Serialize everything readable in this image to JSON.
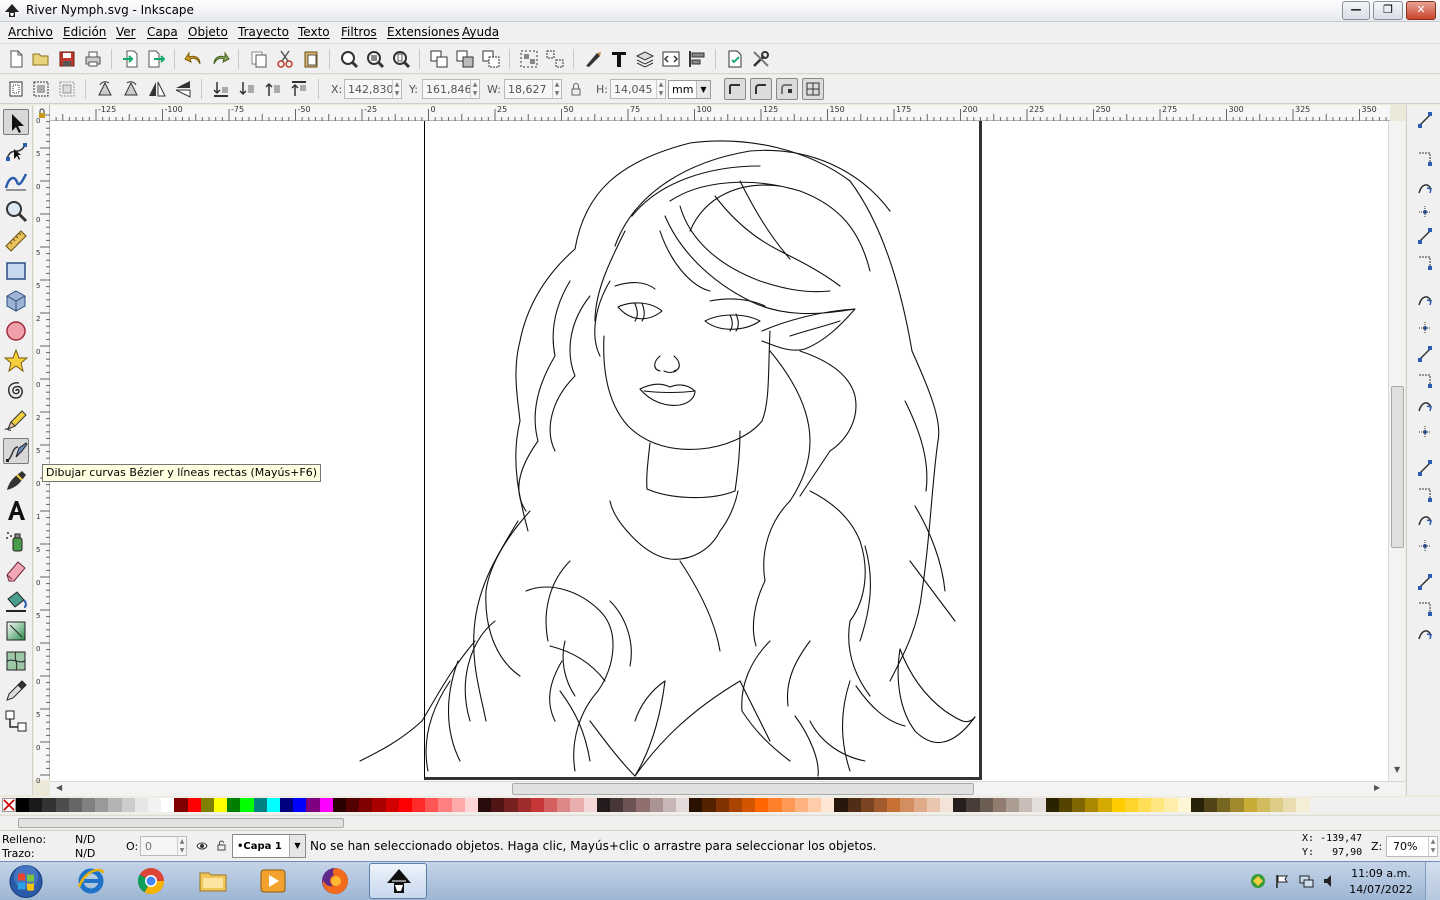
{
  "window": {
    "title": "River Nymph.svg - Inkscape"
  },
  "menu": [
    "Archivo",
    "Edición",
    "Ver",
    "Capa",
    "Objeto",
    "Trayecto",
    "Texto",
    "Filtros",
    "Extensiones",
    "Ayuda"
  ],
  "controls": {
    "x_label": "X:",
    "x_value": "142,830",
    "y_label": "Y:",
    "y_value": "161,846",
    "w_label": "W:",
    "w_value": "18,627",
    "h_label": "H:",
    "h_value": "14,045",
    "unit": "mm"
  },
  "ruler_top": [
    "-125",
    "-100",
    "-75",
    "-50",
    "-25",
    "0",
    "25",
    "50",
    "75",
    "100",
    "125",
    "150",
    "175",
    "200",
    "225",
    "250",
    "275",
    "300",
    "325",
    "350"
  ],
  "ruler_left": [
    "0",
    "5",
    "0",
    "0",
    "5",
    "5",
    "2",
    "0",
    "0",
    "2",
    "5",
    "0",
    "1",
    "5",
    "0",
    "5",
    "0",
    "0",
    "5",
    "0",
    "0"
  ],
  "tooltip": "Dibujar curvas Bézier y líneas rectas (Mayús+F6)",
  "status": {
    "fill_label": "Relleno:",
    "fill_value": "N/D",
    "stroke_label": "Trazo:",
    "stroke_value": "N/D",
    "opacity_label": "O:",
    "opacity_value": "0",
    "layer": "•Capa 1",
    "message": "No se han seleccionado objetos. Haga clic, Mayús+clic o arrastre para seleccionar los objetos.",
    "cursor_x": "X: -139,47",
    "cursor_y": "Y:   97,90",
    "zoom_label": "Z:",
    "zoom_value": "70%"
  },
  "taskbar": {
    "time": "11:09 a.m.",
    "date": "14/07/2022"
  },
  "colors": {
    "accent": "#316ac5",
    "palette": [
      "#000000",
      "#1a1a1a",
      "#333333",
      "#4d4d4d",
      "#666666",
      "#808080",
      "#999999",
      "#b3b3b3",
      "#cccccc",
      "#e6e6e6",
      "#f2f2f2",
      "#ffffff",
      "#800000",
      "#ff0000",
      "#808000",
      "#ffff00",
      "#008000",
      "#00ff00",
      "#008080",
      "#00ffff",
      "#000080",
      "#0000ff",
      "#800080",
      "#ff00ff",
      "#2b0000",
      "#550000",
      "#800000",
      "#aa0000",
      "#d40000",
      "#ff0000",
      "#ff2a2a",
      "#ff5555",
      "#ff8080",
      "#ffaaaa",
      "#ffd5d5",
      "#280b0b",
      "#501616",
      "#782121",
      "#a02c2c",
      "#c83737",
      "#d35f5f",
      "#de8787",
      "#e9afaf",
      "#f4d7d7",
      "#241c1c",
      "#483737",
      "#6c5353",
      "#916f6f",
      "#ac9393",
      "#c8b7b7",
      "#e3dbdb",
      "#2b1100",
      "#552200",
      "#803300",
      "#aa4400",
      "#d45500",
      "#ff6600",
      "#ff7f2a",
      "#ff9955",
      "#ffb380",
      "#ffccaa",
      "#ffe6d5",
      "#28170b",
      "#502d16",
      "#784421",
      "#a05a2c",
      "#c87137",
      "#d38d5f",
      "#deaa87",
      "#e9c6af",
      "#f4e3d7",
      "#241f1c",
      "#483e37",
      "#6c5d53",
      "#917c6f",
      "#ac9d93",
      "#c8beb7",
      "#e3dedb",
      "#2b2200",
      "#554400",
      "#806600",
      "#aa8800",
      "#d4aa00",
      "#ffcc00",
      "#ffd42a",
      "#ffdd55",
      "#ffe680",
      "#ffeeaa",
      "#fff6d5",
      "#28220b",
      "#504416",
      "#786721",
      "#a0892c",
      "#c8ab37",
      "#d3bc5f",
      "#decd87",
      "#e9ddaf",
      "#f4eed7"
    ]
  }
}
